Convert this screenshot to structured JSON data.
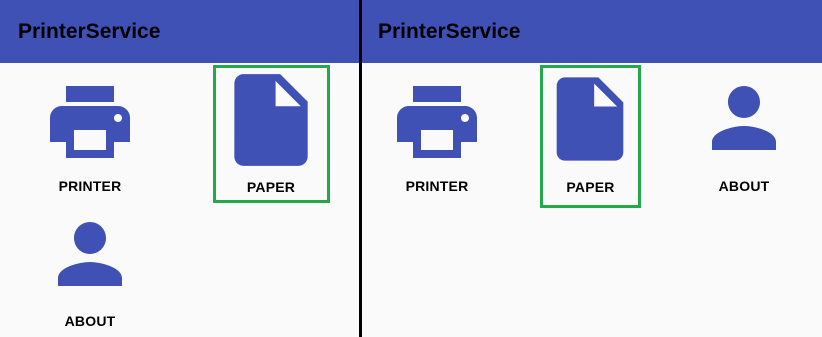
{
  "colors": {
    "primary": "#3f51b5",
    "icon": "#3f51b5",
    "background": "#fafafa",
    "highlight": "#23a84a",
    "divider": "#000000"
  },
  "screens": [
    {
      "orientation": "portrait",
      "appbar": {
        "title": "PrinterService"
      },
      "menu": [
        {
          "label": "PRINTER",
          "icon": "printer-icon"
        },
        {
          "label": "PAPER",
          "icon": "paper-icon",
          "highlighted": true
        },
        {
          "label": "ABOUT",
          "icon": "person-icon"
        }
      ]
    },
    {
      "orientation": "landscape",
      "appbar": {
        "title": "PrinterService"
      },
      "menu": [
        {
          "label": "PRINTER",
          "icon": "printer-icon"
        },
        {
          "label": "PAPER",
          "icon": "paper-icon",
          "highlighted": true
        },
        {
          "label": "ABOUT",
          "icon": "person-icon"
        }
      ]
    }
  ]
}
